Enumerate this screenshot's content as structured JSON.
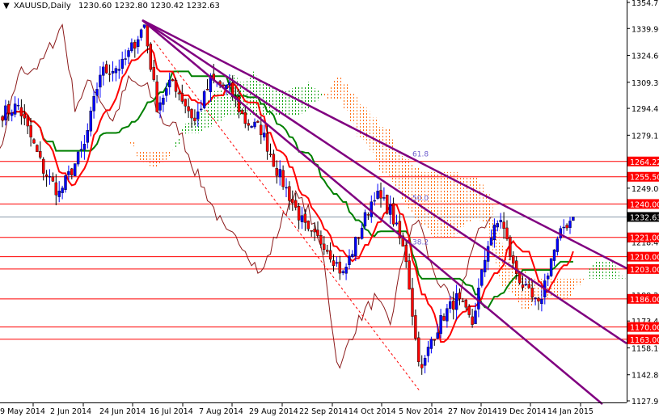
{
  "header": {
    "symbol": "XAUUSD,Daily",
    "ohlc": "1230.60 1232.80 1230.42 1232.63"
  },
  "colors": {
    "up": "#0000ff",
    "down": "#ff0000",
    "level": "#ff0000",
    "trend": "#800080",
    "tenkan": "#ff0000",
    "kijun": "#008000",
    "chikou": "#8b1a1a",
    "cloud_bear": "#ff6600",
    "cloud_bull": "#00a000"
  },
  "chart_data": {
    "type": "candlestick",
    "title": "XAUUSD,Daily",
    "ylim": [
      1127.95,
      1354.75
    ],
    "y_ticks": [
      "1354.75",
      "1339.90",
      "1324.60",
      "1309.30",
      "1294.45",
      "1279.15",
      "1249.00",
      "1218.40",
      "1188.25",
      "1173.40",
      "1158.10",
      "1142.80",
      "1127.95"
    ],
    "x_ticks": [
      "9 May 2014",
      "2 Jun 2014",
      "24 Jun 2014",
      "16 Jul 2014",
      "7 Aug 2014",
      "29 Aug 2014",
      "22 Sep 2014",
      "14 Oct 2014",
      "5 Nov 2014",
      "27 Nov 2014",
      "19 Dec 2014",
      "14 Jan 2015"
    ],
    "close_path": [
      [
        0,
        1291.7
      ],
      [
        5,
        1296
      ],
      [
        13,
        1259.5
      ],
      [
        18,
        1246
      ],
      [
        26,
        1273
      ],
      [
        31,
        1314.7
      ],
      [
        38,
        1319
      ],
      [
        45,
        1342
      ],
      [
        49,
        1296
      ],
      [
        54,
        1310
      ],
      [
        61,
        1287
      ],
      [
        66,
        1310
      ],
      [
        72,
        1305.5
      ],
      [
        77,
        1287
      ],
      [
        82,
        1282.5
      ],
      [
        87,
        1259.5
      ],
      [
        92,
        1241
      ],
      [
        97,
        1222.7
      ],
      [
        102,
        1218
      ],
      [
        108,
        1199.7
      ],
      [
        113,
        1222.7
      ],
      [
        118,
        1246
      ],
      [
        123,
        1236.5
      ],
      [
        128,
        1209
      ],
      [
        131,
        1163
      ],
      [
        133,
        1144.5
      ],
      [
        136,
        1163
      ],
      [
        140,
        1176.7
      ],
      [
        144,
        1186
      ],
      [
        149,
        1172
      ],
      [
        154,
        1218
      ],
      [
        158,
        1232
      ],
      [
        162,
        1204.4
      ],
      [
        166,
        1190.5
      ],
      [
        170,
        1181.3
      ],
      [
        174,
        1209
      ],
      [
        178,
        1227
      ],
      [
        181,
        1232.63
      ]
    ],
    "levels": [
      "1264.22",
      "1255.50",
      "1240.00",
      "1221.00",
      "1210.00",
      "1203.00",
      "1186.00",
      "1170.00",
      "1163.00"
    ],
    "current_price": "1232.63",
    "fibo_labels": [
      "61.8",
      "50.0",
      "38.2"
    ],
    "fibo_prices": [
      1267,
      1242,
      1217
    ]
  }
}
